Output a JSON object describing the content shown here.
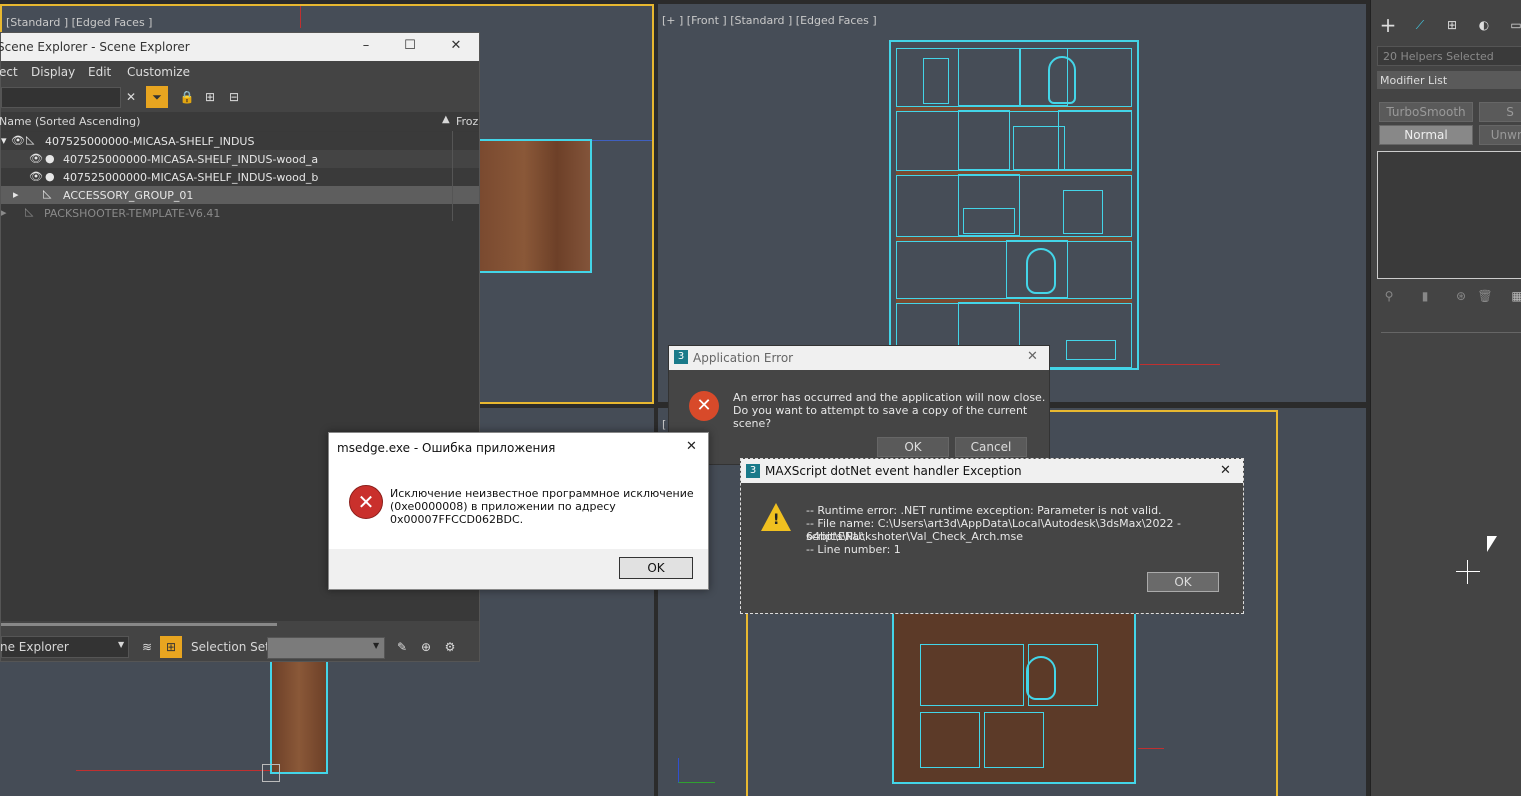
{
  "viewports": {
    "top_left_label": "[Standard ] [Edged Faces ]",
    "front_label": "[+ ] [Front ] [Standard ] [Edged Faces ]",
    "bottom_right_label": "["
  },
  "scene_explorer": {
    "title": "Scene Explorer - Scene Explorer",
    "menu": [
      "ect",
      "Display",
      "Edit",
      "Customize"
    ],
    "column_name": "Name (Sorted Ascending)",
    "column_frozen": "Froz",
    "rows": [
      {
        "label": "407525000000-MICASA-SHELF_INDUS"
      },
      {
        "label": "407525000000-MICASA-SHELF_INDUS-wood_a"
      },
      {
        "label": "407525000000-MICASA-SHELF_INDUS-wood_b"
      },
      {
        "label": "ACCESSORY_GROUP_01"
      },
      {
        "label": "PACKSHOOTER-TEMPLATE-V6.41"
      }
    ],
    "explorer_dropdown": "ne Explorer",
    "selection_set_label": "Selection Set:"
  },
  "app_error": {
    "title": "Application Error",
    "line1": "An error has occurred and the application will now close.",
    "line2": "Do you want to attempt to save a copy of the current scene?",
    "ok": "OK",
    "cancel": "Cancel"
  },
  "msedge_error": {
    "title": "msedge.exe - Ошибка приложения",
    "line1": "Исключение неизвестное программное исключение",
    "line2": "(0xe0000008) в приложении по адресу",
    "line3": "0x00007FFCCD062BDC.",
    "ok": "OK"
  },
  "maxscript_error": {
    "title": "MAXScript dotNet event handler Exception",
    "line1": "-- Runtime error: .NET runtime exception: Parameter is not valid.",
    "line2": "-- File name: C:\\Users\\art3d\\AppData\\Local\\Autodesk\\3dsMax\\2022 - 64bit\\ENU\\",
    "line3": "scripts\\Packshoter\\Val_Check_Arch.mse",
    "line4": "-- Line number: 1",
    "ok": "OK"
  },
  "command_panel": {
    "helpers_selected": "20 Helpers Selected",
    "modifier_list": "Modifier List",
    "btn_turbosmooth": "TurboSmooth",
    "btn_s": "S",
    "btn_normal": "Normal",
    "btn_unwra": "Unwra"
  },
  "colors": {
    "viewport_bg": "#464d57",
    "wire": "#43d5e8",
    "active_border": "#e8b830",
    "wood": "#7a4a30"
  }
}
